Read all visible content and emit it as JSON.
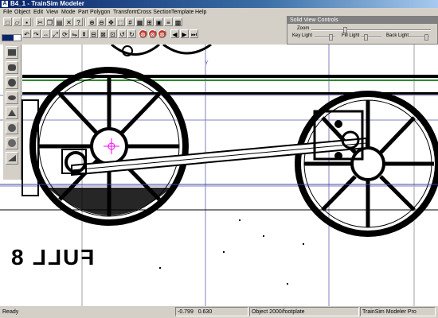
{
  "window": {
    "title": "B4_1 - TrainSim Modeler",
    "icon": "app-icon"
  },
  "menu": [
    "File",
    "Object",
    "Edit",
    "View",
    "Mode",
    "Part",
    "Polygon",
    "Transform",
    "Cross Section",
    "Template",
    "Help"
  ],
  "toolbar": {
    "row1": [
      "new",
      "open",
      "save",
      "cut",
      "copy",
      "paste",
      "delete",
      "help",
      "zoom-in",
      "zoom-out",
      "pan",
      "select",
      "grid"
    ],
    "row2": [
      "undo",
      "redo",
      "move",
      "scale",
      "rotate",
      "rotate-l",
      "stop-x",
      "stop-y",
      "stop-z",
      "prev",
      "next",
      "last"
    ]
  },
  "solid_view_controls": {
    "title": "Solid View Controls",
    "zoom_label": "Zoom",
    "key_light": "Key Light",
    "fill_light": "Fill Light",
    "back_light": "Back Light"
  },
  "viewport": {
    "axis_label": "Y",
    "drawing_text": "FULL 8"
  },
  "tools": [
    "box-icon",
    "cylinder-icon",
    "sphere-icon",
    "tube-icon",
    "cone-icon",
    "ball-icon",
    "ball2-icon",
    "wedge-icon"
  ],
  "status": {
    "state": "Ready",
    "x": "-0.799",
    "y": "0.630",
    "object": "Object 2000/footplate",
    "product": "TrainSim Modeler Pro"
  }
}
